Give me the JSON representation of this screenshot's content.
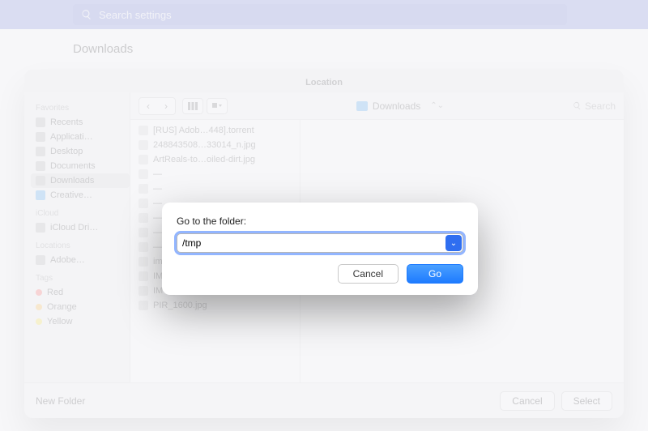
{
  "topbar": {
    "search_placeholder": "Search settings"
  },
  "page": {
    "title": "Downloads"
  },
  "open_panel": {
    "title": "Location",
    "path_label": "Downloads",
    "search_label": "Search",
    "footer": {
      "new_folder": "New Folder",
      "cancel": "Cancel",
      "select": "Select"
    },
    "sidebar": {
      "groups": [
        {
          "label": "Favorites",
          "items": [
            {
              "label": "Recents",
              "icon": "clock"
            },
            {
              "label": "Applicati…",
              "icon": "app"
            },
            {
              "label": "Desktop",
              "icon": "desktop"
            },
            {
              "label": "Documents",
              "icon": "doc"
            },
            {
              "label": "Downloads",
              "icon": "down",
              "selected": true
            },
            {
              "label": "Creative…",
              "icon": "folder",
              "blue": true
            }
          ]
        },
        {
          "label": "iCloud",
          "items": [
            {
              "label": "iCloud Dri…",
              "icon": "cloud"
            }
          ]
        },
        {
          "label": "Locations",
          "items": [
            {
              "label": "Adobe…",
              "icon": "disk"
            }
          ]
        },
        {
          "label": "Tags",
          "items": [
            {
              "label": "Red",
              "dot": "#fc605b"
            },
            {
              "label": "Orange",
              "dot": "#fdbc40"
            },
            {
              "label": "Yellow",
              "dot": "#f8e23b"
            }
          ]
        }
      ]
    },
    "files": [
      "[RUS] Adob…448].torrent",
      "248843508…33014_n.jpg",
      "ArtReals-to…oiled-dirt.jpg",
      "—",
      "—",
      "—",
      "—",
      "—",
      "—",
      "images.psd",
      "IMG_0397 (1).HEIC",
      "IMG_0397.HEIC",
      "PIR_1600.jpg"
    ]
  },
  "goto": {
    "label": "Go to the folder:",
    "value": "/tmp",
    "cancel": "Cancel",
    "go": "Go"
  }
}
